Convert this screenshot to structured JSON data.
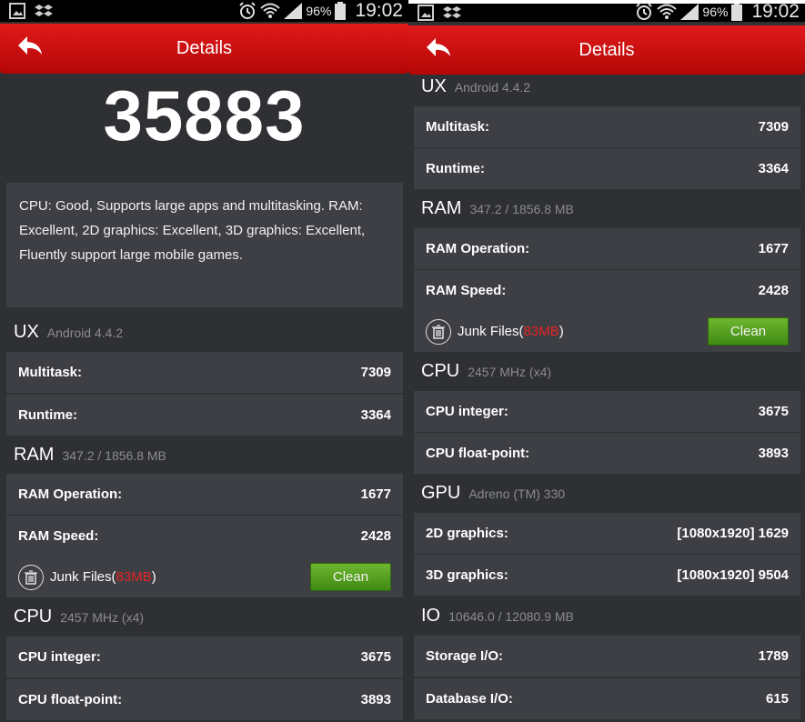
{
  "status_bar": {
    "battery_pct": "96%",
    "time": "19:02"
  },
  "header": {
    "title": "Details"
  },
  "score": "35883",
  "description": "CPU: Good, Supports large apps and multitasking. RAM: Excellent, 2D graphics: Excellent, 3D graphics: Excellent, Fluently support large mobile games.",
  "ux": {
    "title": "UX",
    "subtitle": "Android 4.4.2",
    "multitask_label": "Multitask:",
    "multitask_value": "7309",
    "runtime_label": "Runtime:",
    "runtime_value": "3364"
  },
  "ram": {
    "title": "RAM",
    "subtitle": "347.2 / 1856.8 MB",
    "op_label": "RAM Operation:",
    "op_value": "1677",
    "speed_label": "RAM Speed:",
    "speed_value": "2428",
    "junk_prefix": "Junk Files(",
    "junk_size": "83MB",
    "junk_suffix": ")",
    "clean_label": "Clean"
  },
  "cpu": {
    "title": "CPU",
    "subtitle": "2457 MHz (x4)",
    "int_label": "CPU integer:",
    "int_value": "3675",
    "float_label": "CPU float-point:",
    "float_value": "3893"
  },
  "gpu": {
    "title": "GPU",
    "subtitle": "Adreno (TM) 330",
    "g2d_label": "2D graphics:",
    "g2d_value": "[1080x1920] 1629",
    "g3d_label": "3D graphics:",
    "g3d_value": "[1080x1920] 9504"
  },
  "io": {
    "title": "IO",
    "subtitle": "10646.0 / 12080.9 MB",
    "storage_label": "Storage I/O:",
    "storage_value": "1789",
    "db_label": "Database I/O:",
    "db_value": "615"
  }
}
